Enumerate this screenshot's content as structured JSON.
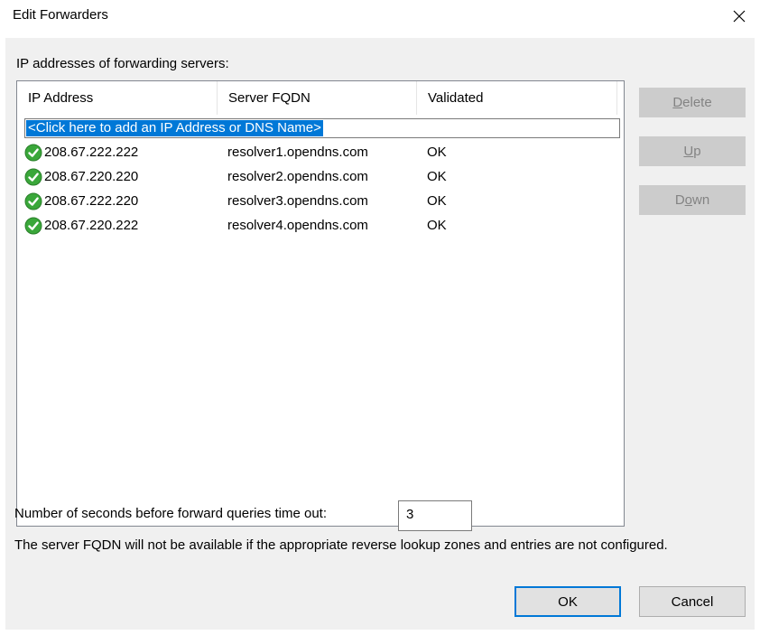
{
  "window": {
    "title": "Edit Forwarders",
    "close_glyph": "✕"
  },
  "servers_label": "IP addresses of forwarding servers:",
  "list": {
    "columns": [
      "IP Address",
      "Server FQDN",
      "Validated"
    ],
    "add_prompt": "<Click here to add an IP Address or DNS Name>",
    "rows": [
      {
        "ip": "208.67.222.222",
        "fqdn": "resolver1.opendns.com",
        "validated": "OK",
        "icon": "check-circle-icon"
      },
      {
        "ip": "208.67.220.220",
        "fqdn": "resolver2.opendns.com",
        "validated": "OK",
        "icon": "check-circle-icon"
      },
      {
        "ip": "208.67.222.220",
        "fqdn": "resolver3.opendns.com",
        "validated": "OK",
        "icon": "check-circle-icon"
      },
      {
        "ip": "208.67.220.222",
        "fqdn": "resolver4.opendns.com",
        "validated": "OK",
        "icon": "check-circle-icon"
      }
    ]
  },
  "side_buttons": {
    "delete": {
      "mnemonic": "D",
      "rest": "elete"
    },
    "up": {
      "mnemonic": "U",
      "rest": "p"
    },
    "down": {
      "pre": "D",
      "mnemonic": "o",
      "rest": "wn"
    }
  },
  "timeout": {
    "label": "Number of seconds before forward queries time out:",
    "value": "3"
  },
  "note": "The server FQDN will not be available if the appropriate reverse lookup zones and entries are not configured.",
  "buttons": {
    "ok": "OK",
    "cancel": "Cancel"
  },
  "colors": {
    "selection": "#0078d7",
    "check_green": "#3aa73a",
    "disabled_button": "#cccccc",
    "dialog_bg": "#f0f0f0"
  }
}
